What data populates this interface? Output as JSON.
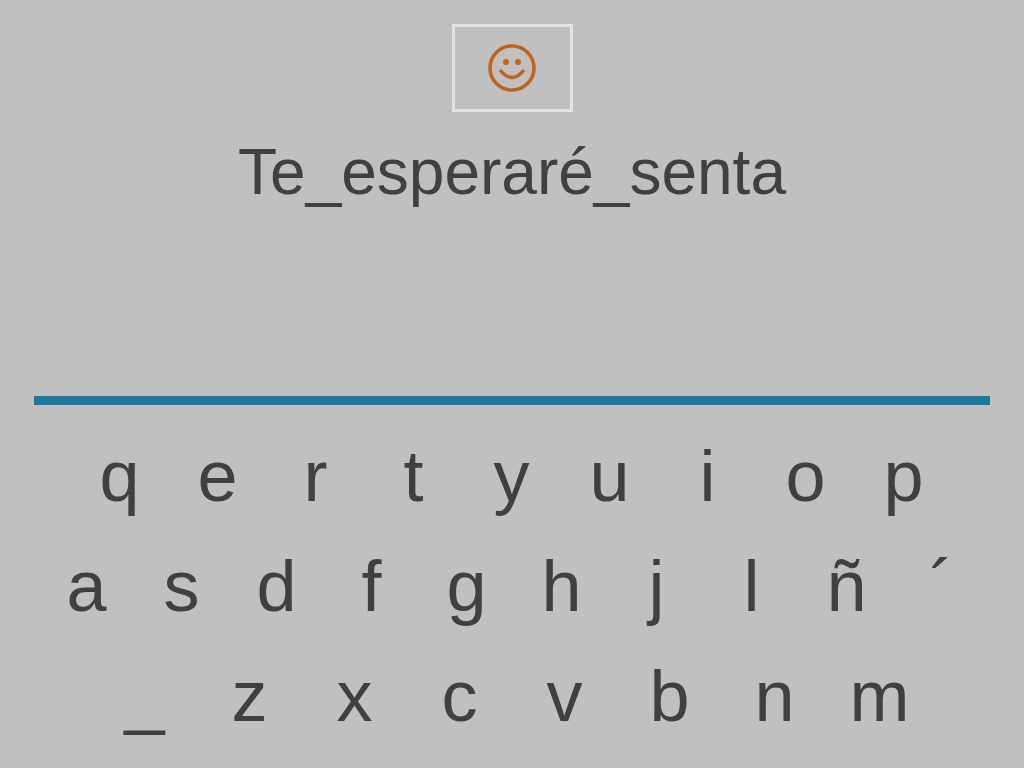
{
  "feedback": {
    "kind": "smile"
  },
  "phrase": "Te_esperaré_senta",
  "keyboard": {
    "rows": [
      [
        "q",
        "e",
        "r",
        "t",
        "y",
        "u",
        "i",
        "o",
        "p"
      ],
      [
        "a",
        "s",
        "d",
        "f",
        "g",
        "h",
        "j",
        "l",
        "ñ",
        "´"
      ],
      [
        "_",
        "z",
        "x",
        "c",
        "v",
        "b",
        "n",
        "m"
      ]
    ]
  }
}
